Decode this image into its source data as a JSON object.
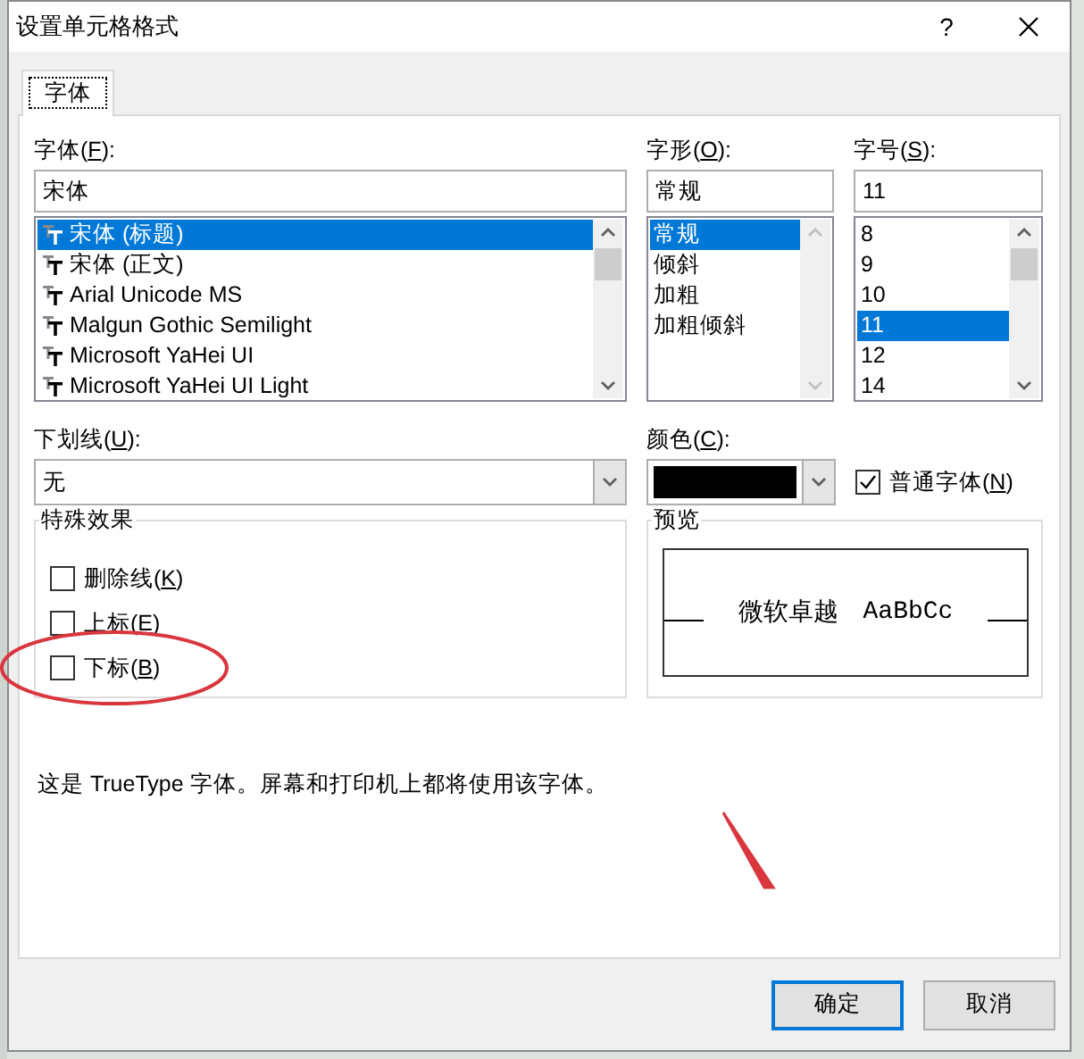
{
  "window": {
    "title": "设置单元格格式",
    "help": "?"
  },
  "tabs": [
    {
      "label": "字体",
      "selected": true
    }
  ],
  "font": {
    "label": "字体(F):",
    "value": "宋体",
    "scrollbar": {
      "disabled": false
    },
    "items": [
      {
        "label": "宋体 (标题)",
        "selected": true
      },
      {
        "label": "宋体 (正文)",
        "selected": false
      },
      {
        "label": "Arial Unicode MS",
        "selected": false
      },
      {
        "label": "Malgun Gothic Semilight",
        "selected": false
      },
      {
        "label": "Microsoft YaHei UI",
        "selected": false
      },
      {
        "label": "Microsoft YaHei UI Light",
        "selected": false
      }
    ]
  },
  "style": {
    "label": "字形(O):",
    "value": "常规",
    "scrollbar": {
      "disabled": true
    },
    "items": [
      {
        "label": "常规",
        "selected": true
      },
      {
        "label": "倾斜",
        "selected": false
      },
      {
        "label": "加粗",
        "selected": false
      },
      {
        "label": "加粗倾斜",
        "selected": false
      }
    ]
  },
  "size": {
    "label": "字号(S):",
    "value": "11",
    "scrollbar": {
      "disabled": false
    },
    "items": [
      {
        "label": "8",
        "selected": false
      },
      {
        "label": "9",
        "selected": false
      },
      {
        "label": "10",
        "selected": false
      },
      {
        "label": "11",
        "selected": true
      },
      {
        "label": "12",
        "selected": false
      },
      {
        "label": "14",
        "selected": false
      }
    ]
  },
  "underline": {
    "label": "下划线(U):",
    "value": "无"
  },
  "color": {
    "label": "颜色(C):",
    "color": "#000000"
  },
  "normal_font": {
    "label": "普通字体(N)",
    "checked": true
  },
  "effects": {
    "title": "特殊效果",
    "options": [
      {
        "label": "删除线(K)",
        "checked": false
      },
      {
        "label": "上标(E)",
        "checked": false
      },
      {
        "label": "下标(B)",
        "checked": false
      }
    ]
  },
  "preview": {
    "title": "预览",
    "sample_cjk": "微软卓越",
    "sample_latin": "AaBbCc"
  },
  "note": "这是 TrueType 字体。屏幕和打印机上都将使用该字体。",
  "buttons": [
    {
      "label": "确定",
      "default": true
    },
    {
      "label": "取消",
      "default": false
    }
  ]
}
